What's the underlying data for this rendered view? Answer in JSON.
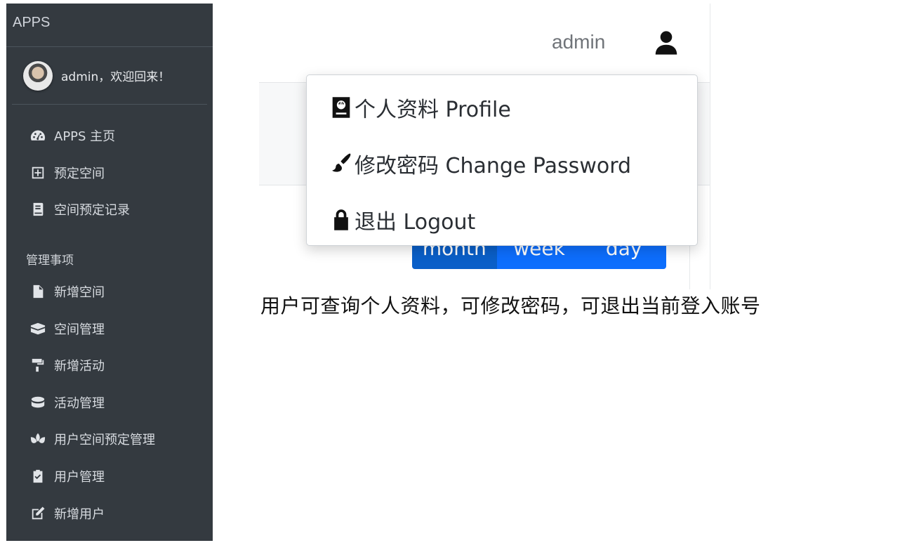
{
  "sidebar": {
    "brand": "APPS",
    "user_greeting": "admin，欢迎回来！",
    "items": [
      {
        "label": "APPS 主页",
        "icon": "dashboard-gauge-icon"
      },
      {
        "label": "预定空间",
        "icon": "plus-square-icon"
      },
      {
        "label": "空间预定记录",
        "icon": "book-icon"
      }
    ],
    "section_header": "管理事项",
    "admin_items": [
      {
        "label": "新增空间",
        "icon": "file-icon"
      },
      {
        "label": "空间管理",
        "icon": "kaaba-icon"
      },
      {
        "label": "新增活动",
        "icon": "paint-roller-icon"
      },
      {
        "label": "活动管理",
        "icon": "database-icon"
      },
      {
        "label": "用户空间预定管理",
        "icon": "spa-icon"
      },
      {
        "label": "用户管理",
        "icon": "clipboard-check-icon"
      },
      {
        "label": "新增用户",
        "icon": "edit-icon"
      }
    ]
  },
  "topbar": {
    "username": "admin",
    "user_icon": "user-icon"
  },
  "calendar": {
    "view_buttons": [
      "month",
      "week",
      "day"
    ]
  },
  "dropdown": {
    "items": [
      {
        "label": "个人资料 Profile",
        "icon": "passport-icon"
      },
      {
        "label": "修改密码 Change Password",
        "icon": "paint-brush-icon"
      },
      {
        "label": "退出 Logout",
        "icon": "lock-icon"
      }
    ]
  },
  "caption": "用户可查询个人资料，可修改密码，可退出当前登入账号",
  "colors": {
    "sidebar_bg": "#343a40",
    "primary": "#0d6efd",
    "primary_active": "#0a5fc8"
  }
}
